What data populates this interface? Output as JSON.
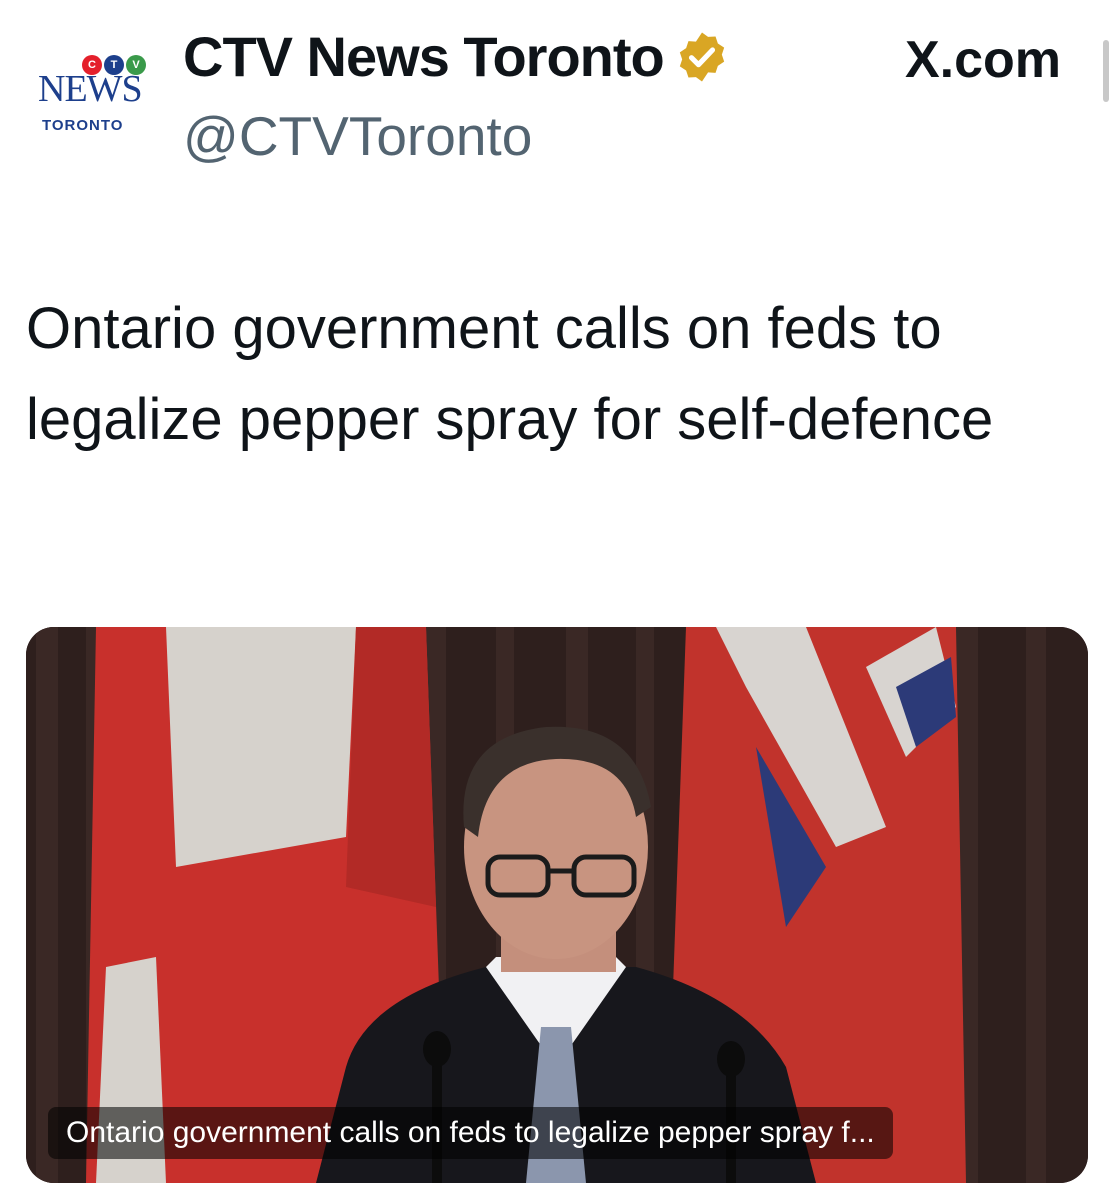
{
  "account": {
    "logo": {
      "top": "CTV",
      "name": "NEWS",
      "city": "TORONTO",
      "colors": [
        "#e4202b",
        "#1d3f8c",
        "#3a9a4a"
      ]
    },
    "display_name": "CTV News Toronto",
    "verified_icon": "verified-badge-icon",
    "verified_color": "#d9a624",
    "handle": "@CTVToronto"
  },
  "site": "X.com",
  "headline": "Ontario government calls on feds to legalize pepper spray for self-defence",
  "media": {
    "icon": "press-conference-photo",
    "caption": "Ontario government calls on feds to legalize pepper spray f..."
  }
}
